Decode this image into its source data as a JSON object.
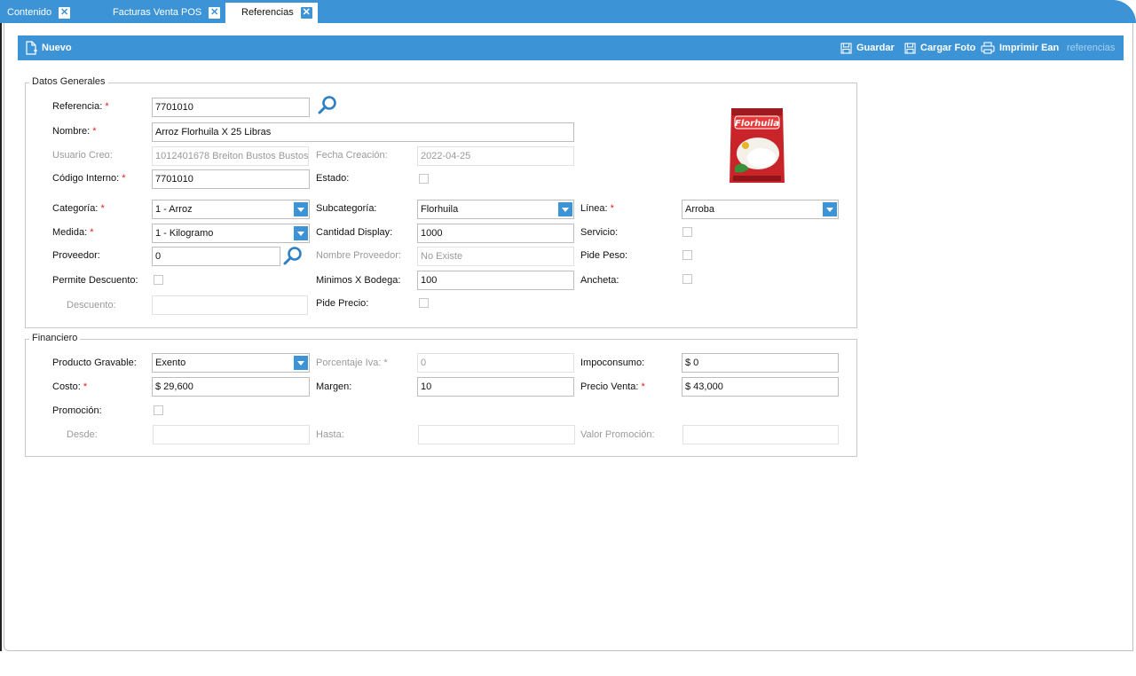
{
  "tabs": [
    {
      "label": "Contenido",
      "close": "✕"
    },
    {
      "label": "Facturas Venta POS",
      "close": "✕"
    },
    {
      "label": "Referencias",
      "close": "✕"
    }
  ],
  "toolbar": {
    "nuevo": "Nuevo",
    "guardar": "Guardar",
    "cargar_foto": "Cargar Foto",
    "imprimir_ean": "Imprimir Ean",
    "referencias": "referencias"
  },
  "datos_generales": {
    "legend": "Datos Generales",
    "referencia": {
      "label": "Referencia:",
      "value": "7701010"
    },
    "nombre": {
      "label": "Nombre:",
      "value": "Arroz Florhuila X 25 Libras"
    },
    "usuario_creo": {
      "label": "Usuario Creo:",
      "value": "1012401678 Breiton Bustos Bustos"
    },
    "fecha_creacion": {
      "label": "Fecha Creación:",
      "value": "2022-04-25"
    },
    "codigo_interno": {
      "label": "Código Interno:",
      "value": "7701010"
    },
    "estado": {
      "label": "Estado:"
    },
    "categoria": {
      "label": "Categoría:",
      "value": "1 - Arroz"
    },
    "subcategoria": {
      "label": "Subcategoría:",
      "value": "Florhuila"
    },
    "linea": {
      "label": "Línea:",
      "value": "Arroba"
    },
    "medida": {
      "label": "Medida:",
      "value": "1 - Kilogramo"
    },
    "cantidad_display": {
      "label": "Cantidad Display:",
      "value": "1000"
    },
    "servicio": {
      "label": "Servicio:"
    },
    "proveedor": {
      "label": "Proveedor:",
      "value": "0"
    },
    "nombre_proveedor": {
      "label": "Nombre Proveedor:",
      "value": "No Existe"
    },
    "pide_peso": {
      "label": "Pide Peso:"
    },
    "permite_descuento": {
      "label": "Permite Descuento:"
    },
    "minimos_bodega": {
      "label": "Minimos X Bodega:",
      "value": "100"
    },
    "ancheta": {
      "label": "Ancheta:"
    },
    "descuento": {
      "label": "Descuento:",
      "value": ""
    },
    "pide_precio": {
      "label": "Pide Precio:"
    },
    "product_image_brand": "Florhuila"
  },
  "financiero": {
    "legend": "Financiero",
    "producto_gravable": {
      "label": "Producto Gravable:",
      "value": "Exento"
    },
    "porcentaje_iva": {
      "label": "Porcentaje Iva:",
      "value": "0"
    },
    "impoconsumo": {
      "label": "Impoconsumo:",
      "value": "$ 0"
    },
    "costo": {
      "label": "Costo:",
      "value": "$ 29,600"
    },
    "margen": {
      "label": "Margen:",
      "value": "10"
    },
    "precio_venta": {
      "label": "Precio Venta:",
      "value": "$ 43,000"
    },
    "promocion": {
      "label": "Promoción:"
    },
    "desde": {
      "label": "Desde:",
      "value": ""
    },
    "hasta": {
      "label": "Hasta:",
      "value": ""
    },
    "valor_promocion": {
      "label": "Valor Promoción:",
      "value": ""
    }
  },
  "required_mark": "*",
  "colors": {
    "accent": "#3c94d6",
    "required": "#e02020"
  }
}
